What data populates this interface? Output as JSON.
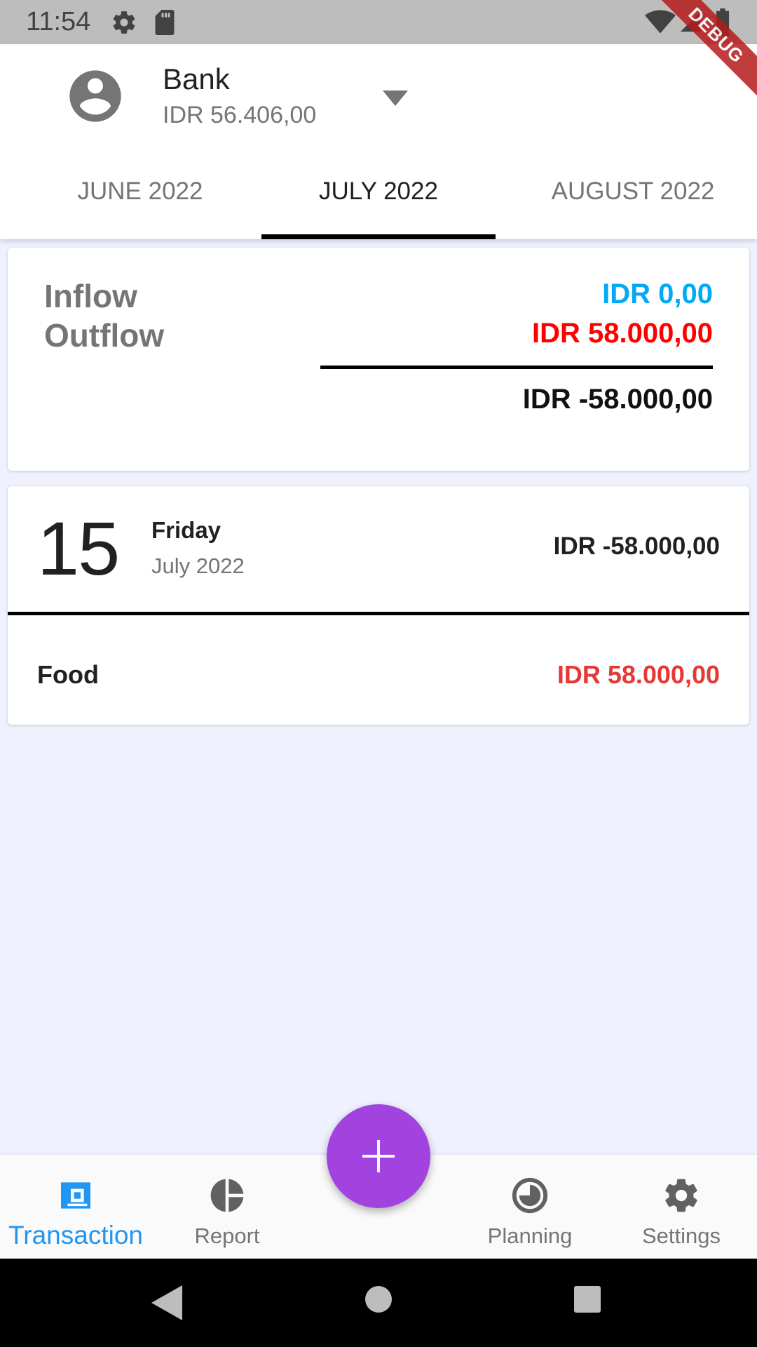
{
  "status_bar": {
    "time": "11:54",
    "debug_label": "DEBUG"
  },
  "account": {
    "name": "Bank",
    "balance": "IDR 56.406,00"
  },
  "tabs": [
    {
      "label": "JUNE 2022",
      "selected": false
    },
    {
      "label": "JULY 2022",
      "selected": true
    },
    {
      "label": "AUGUST 2022",
      "selected": false
    }
  ],
  "summary": {
    "inflow_label": "Inflow",
    "outflow_label": "Outflow",
    "inflow_value": "IDR 0,00",
    "outflow_value": "IDR 58.000,00",
    "net_value": "IDR -58.000,00"
  },
  "day_group": {
    "day": "15",
    "weekday": "Friday",
    "month_year": "July 2022",
    "total": "IDR -58.000,00",
    "transactions": [
      {
        "category": "Food",
        "amount": "IDR 58.000,00"
      }
    ]
  },
  "bottom_nav": {
    "items": [
      {
        "label": "Transaction",
        "icon": "wallet-icon",
        "active": true
      },
      {
        "label": "Report",
        "icon": "pie-chart-icon",
        "active": false
      },
      {
        "label": "Planning",
        "icon": "clock-icon",
        "active": false
      },
      {
        "label": "Settings",
        "icon": "gear-icon",
        "active": false
      }
    ],
    "fab_icon": "plus-icon"
  },
  "colors": {
    "accent": "#2196f3",
    "fab": "#a243e0",
    "inflow": "#03a9f4",
    "outflow": "#ff0000",
    "background": "#eff1ff"
  }
}
